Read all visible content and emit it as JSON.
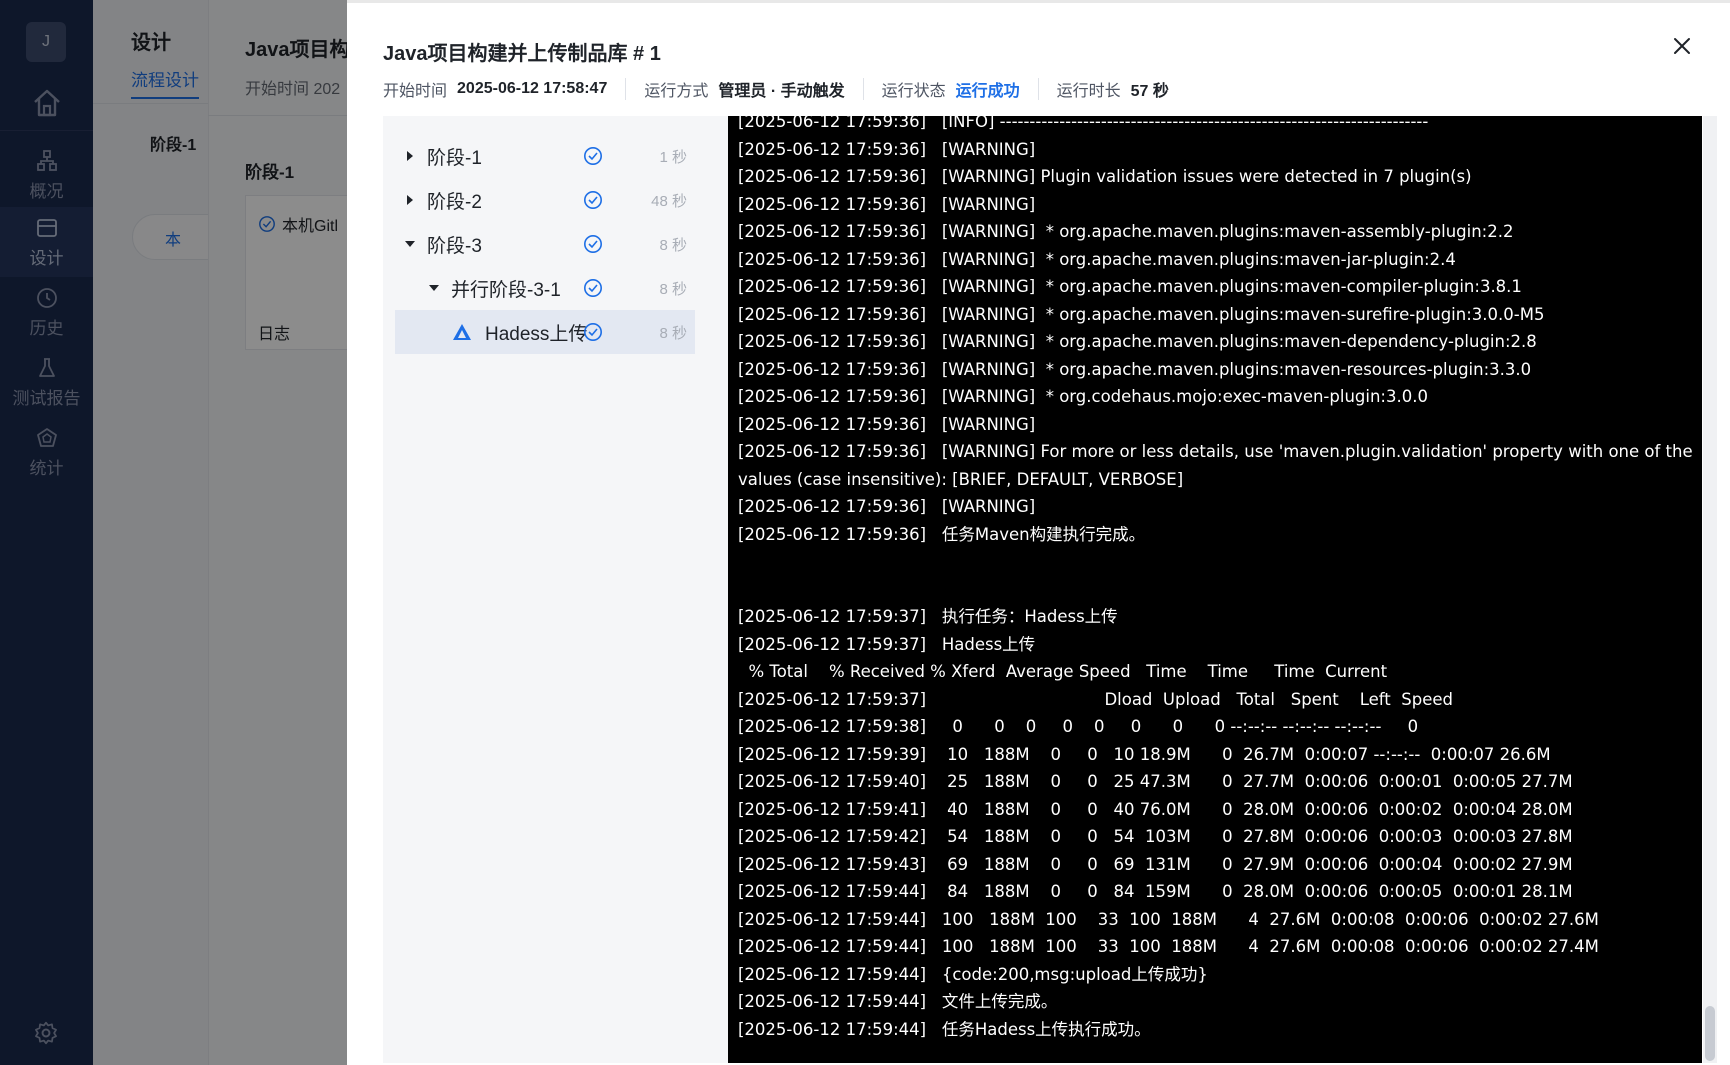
{
  "nav": {
    "avatar": "J",
    "items": [
      {
        "label": "概况",
        "icon": "overview-icon"
      },
      {
        "label": "设计",
        "icon": "design-icon"
      },
      {
        "label": "历史",
        "icon": "history-icon"
      },
      {
        "label": "测试报告",
        "icon": "test-report-icon"
      },
      {
        "label": "统计",
        "icon": "statistics-icon"
      }
    ]
  },
  "background": {
    "title": "设计",
    "tab": "流程设计",
    "stage": "阶段-1",
    "pill_label": "本",
    "panel_title": "Java项目构",
    "panel_start": "开始时间  202",
    "panel_stage": "阶段-1",
    "panel_job": "本机Gitl",
    "panel_log": "日志"
  },
  "drawer": {
    "title": "Java项目构建并上传制品库 # 1",
    "meta": {
      "start_label": "开始时间",
      "start_value": "2025-06-12 17:58:47",
      "mode_label": "运行方式",
      "mode_value": "管理员 · 手动触发",
      "status_label": "运行状态",
      "status_value": "运行成功",
      "duration_label": "运行时长",
      "duration_value": "57 秒"
    },
    "colors": {
      "accent": "#1e6fe6",
      "success": "#1e6fe6"
    },
    "tree": [
      {
        "label": "阶段-1",
        "duration": "1 秒",
        "expanded": false
      },
      {
        "label": "阶段-2",
        "duration": "48 秒",
        "expanded": false
      },
      {
        "label": "阶段-3",
        "duration": "8 秒",
        "expanded": true
      },
      {
        "label": "并行阶段-3-1",
        "duration": "8 秒",
        "expanded": true
      },
      {
        "label": "Hadess上传",
        "duration": "8 秒",
        "selected": true
      }
    ],
    "log_lines": [
      "[2025-06-12 17:59:36]   [INFO] ------------------------------------------------------------------------",
      "[2025-06-12 17:59:36]   [WARNING]",
      "[2025-06-12 17:59:36]   [WARNING] Plugin validation issues were detected in 7 plugin(s)",
      "[2025-06-12 17:59:36]   [WARNING]",
      "[2025-06-12 17:59:36]   [WARNING]  * org.apache.maven.plugins:maven-assembly-plugin:2.2",
      "[2025-06-12 17:59:36]   [WARNING]  * org.apache.maven.plugins:maven-jar-plugin:2.4",
      "[2025-06-12 17:59:36]   [WARNING]  * org.apache.maven.plugins:maven-compiler-plugin:3.8.1",
      "[2025-06-12 17:59:36]   [WARNING]  * org.apache.maven.plugins:maven-surefire-plugin:3.0.0-M5",
      "[2025-06-12 17:59:36]   [WARNING]  * org.apache.maven.plugins:maven-dependency-plugin:2.8",
      "[2025-06-12 17:59:36]   [WARNING]  * org.apache.maven.plugins:maven-resources-plugin:3.3.0",
      "[2025-06-12 17:59:36]   [WARNING]  * org.codehaus.mojo:exec-maven-plugin:3.0.0",
      "[2025-06-12 17:59:36]   [WARNING]",
      "[2025-06-12 17:59:36]   [WARNING] For more or less details, use 'maven.plugin.validation' property with one of the values (case insensitive): [BRIEF, DEFAULT, VERBOSE]",
      "[2025-06-12 17:59:36]   [WARNING]",
      "[2025-06-12 17:59:36]   任务Maven构建执行完成。",
      "",
      "",
      "[2025-06-12 17:59:37]   执行任务：Hadess上传",
      "[2025-06-12 17:59:37]   Hadess上传",
      "  % Total    % Received % Xferd  Average Speed   Time    Time     Time  Current",
      "[2025-06-12 17:59:37]                                  Dload  Upload   Total   Spent    Left  Speed",
      "[2025-06-12 17:59:38]     0      0    0     0    0     0      0      0 --:--:-- --:--:-- --:--:--     0",
      "[2025-06-12 17:59:39]    10   188M    0     0   10 18.9M      0  26.7M  0:00:07 --:--:--  0:00:07 26.6M",
      "[2025-06-12 17:59:40]    25   188M    0     0   25 47.3M      0  27.7M  0:00:06  0:00:01  0:00:05 27.7M",
      "[2025-06-12 17:59:41]    40   188M    0     0   40 76.0M      0  28.0M  0:00:06  0:00:02  0:00:04 28.0M",
      "[2025-06-12 17:59:42]    54   188M    0     0   54  103M      0  27.8M  0:00:06  0:00:03  0:00:03 27.8M",
      "[2025-06-12 17:59:43]    69   188M    0     0   69  131M      0  27.9M  0:00:06  0:00:04  0:00:02 27.9M",
      "[2025-06-12 17:59:44]    84   188M    0     0   84  159M      0  28.0M  0:00:06  0:00:05  0:00:01 28.1M",
      "[2025-06-12 17:59:44]   100   188M  100    33  100  188M      4  27.6M  0:00:08  0:00:06  0:00:02 27.6M",
      "[2025-06-12 17:59:44]   100   188M  100    33  100  188M      4  27.6M  0:00:08  0:00:06  0:00:02 27.4M",
      "[2025-06-12 17:59:44]   {code:200,msg:upload上传成功}",
      "[2025-06-12 17:59:44]   文件上传完成。",
      "[2025-06-12 17:59:44]   任务Hadess上传执行成功。"
    ]
  }
}
